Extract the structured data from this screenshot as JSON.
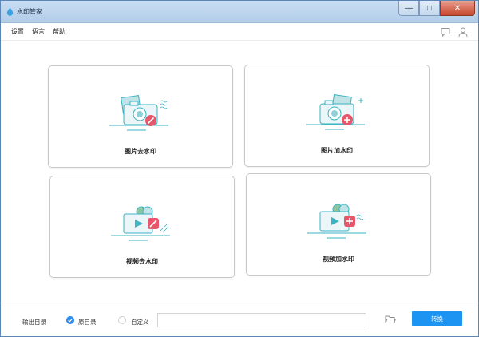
{
  "window": {
    "title": "水印管家"
  },
  "window_controls": {
    "minimize": "—",
    "maximize": "□",
    "close": "✕"
  },
  "menu": {
    "settings": "设置",
    "language": "语言",
    "help": "帮助"
  },
  "icons": {
    "chat": "chat-bubble-icon",
    "user": "user-icon",
    "folder": "folder-icon"
  },
  "cards": [
    {
      "label": "图片去水印",
      "icon": "photo-remove-watermark-icon"
    },
    {
      "label": "图片加水印",
      "icon": "photo-add-watermark-icon"
    },
    {
      "label": "视频去水印",
      "icon": "video-remove-watermark-icon"
    },
    {
      "label": "视频加水印",
      "icon": "video-add-watermark-icon"
    }
  ],
  "bottom": {
    "output_label": "输出目录",
    "option_original": "原目录",
    "option_custom": "自定义",
    "selected_option": "原目录",
    "path_value": "",
    "path_placeholder": "",
    "convert_label": "转换"
  },
  "colors": {
    "accent": "#1e94f2",
    "icon_teal": "#3bb3c3",
    "icon_red": "#e8566c",
    "icon_green": "#8cc6a0"
  }
}
